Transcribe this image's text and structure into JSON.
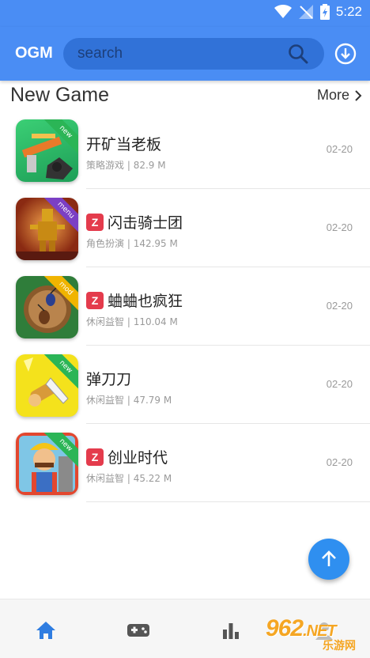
{
  "status_bar": {
    "time": "5:22"
  },
  "app_bar": {
    "logo": "OGM",
    "search": {
      "placeholder": "search",
      "value": ""
    }
  },
  "section": {
    "title": "New Game",
    "more_label": "More"
  },
  "games": [
    {
      "name": "开矿当老板",
      "category": "策略游戏",
      "size": "82.9 M",
      "date": "02-20",
      "z_badge": false,
      "ribbon": "new",
      "ribbon_color": "#2bb556"
    },
    {
      "name": "闪击骑士团",
      "category": "角色扮演",
      "size": "142.95 M",
      "date": "02-20",
      "z_badge": true,
      "ribbon": "menu",
      "ribbon_color": "#7b3fc4"
    },
    {
      "name": "蛐蛐也疯狂",
      "category": "休闲益智",
      "size": "110.04 M",
      "date": "02-20",
      "z_badge": true,
      "ribbon": "mod",
      "ribbon_color": "#f0b400"
    },
    {
      "name": "弹刀刀",
      "category": "休闲益智",
      "size": "47.79 M",
      "date": "02-20",
      "z_badge": false,
      "ribbon": "new",
      "ribbon_color": "#2bb556"
    },
    {
      "name": "创业时代",
      "category": "休闲益智",
      "size": "45.22 M",
      "date": "02-20",
      "z_badge": true,
      "ribbon": "new",
      "ribbon_color": "#2bb556"
    }
  ],
  "z_badge_label": "Z",
  "meta_separator": " | ",
  "bottom_nav": [
    "home-icon",
    "gamepad-icon",
    "bar-chart-icon",
    "profile-icon"
  ],
  "watermark": {
    "brand": "962",
    "suffix": ".NET",
    "sub": "乐游网"
  },
  "colors": {
    "primary": "#4a8df4",
    "search_bg": "#3172d8",
    "fab": "#2f8ff0",
    "badge": "#e43b4c",
    "active_tab": "#2f7de1"
  }
}
